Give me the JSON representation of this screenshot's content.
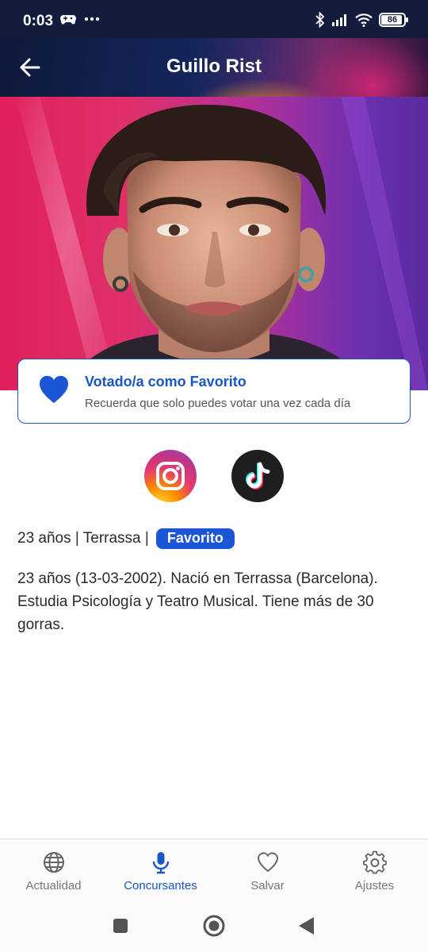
{
  "status_bar": {
    "time": "0:03",
    "battery": "86"
  },
  "header": {
    "title": "Guillo Rist"
  },
  "vote_card": {
    "title": "Votado/a como Favorito",
    "subtitle": "Recuerda que solo puedes votar una vez cada día"
  },
  "profile": {
    "meta": "23 años | Terrassa |",
    "badge": "Favorito",
    "bio": "23 años (13-03-2002). Nació en Terrassa (Barcelona). Estudia Psicología y Teatro Musical. Tiene más de 30 gorras."
  },
  "social": [
    "instagram-icon",
    "tiktok-icon"
  ],
  "bottom_nav": {
    "items": [
      {
        "label": "Actualidad",
        "icon": "globe-icon"
      },
      {
        "label": "Concursantes",
        "icon": "microphone-icon",
        "active": true
      },
      {
        "label": "Salvar",
        "icon": "heart-icon"
      },
      {
        "label": "Ajustes",
        "icon": "gear-icon"
      }
    ]
  },
  "colors": {
    "accent": "#1a56c4",
    "status_bar": "#121c3c",
    "badge": "#1a56d6"
  }
}
